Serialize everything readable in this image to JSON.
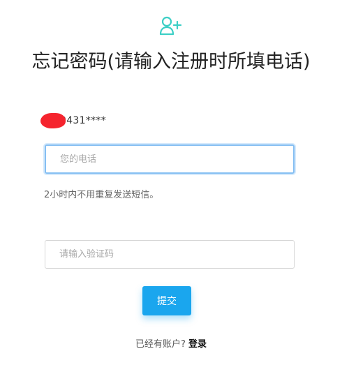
{
  "header": {
    "icon": "user-plus-icon",
    "title": "忘记密码(请输入注册时所填电话)"
  },
  "account": {
    "masked_phone": "0431****"
  },
  "form": {
    "phone_placeholder": "您的电话",
    "phone_value": "",
    "hint": "2小时内不用重复发送短信。",
    "code_placeholder": "请输入验证码",
    "code_value": "",
    "submit_label": "提交"
  },
  "footer": {
    "prompt": "已经有账户?",
    "login_label": "登录"
  },
  "colors": {
    "accent_icon": "#3ccfc6",
    "submit_button": "#1aa6ee",
    "focus_border": "#86bff2",
    "redaction": "#f5242e"
  }
}
